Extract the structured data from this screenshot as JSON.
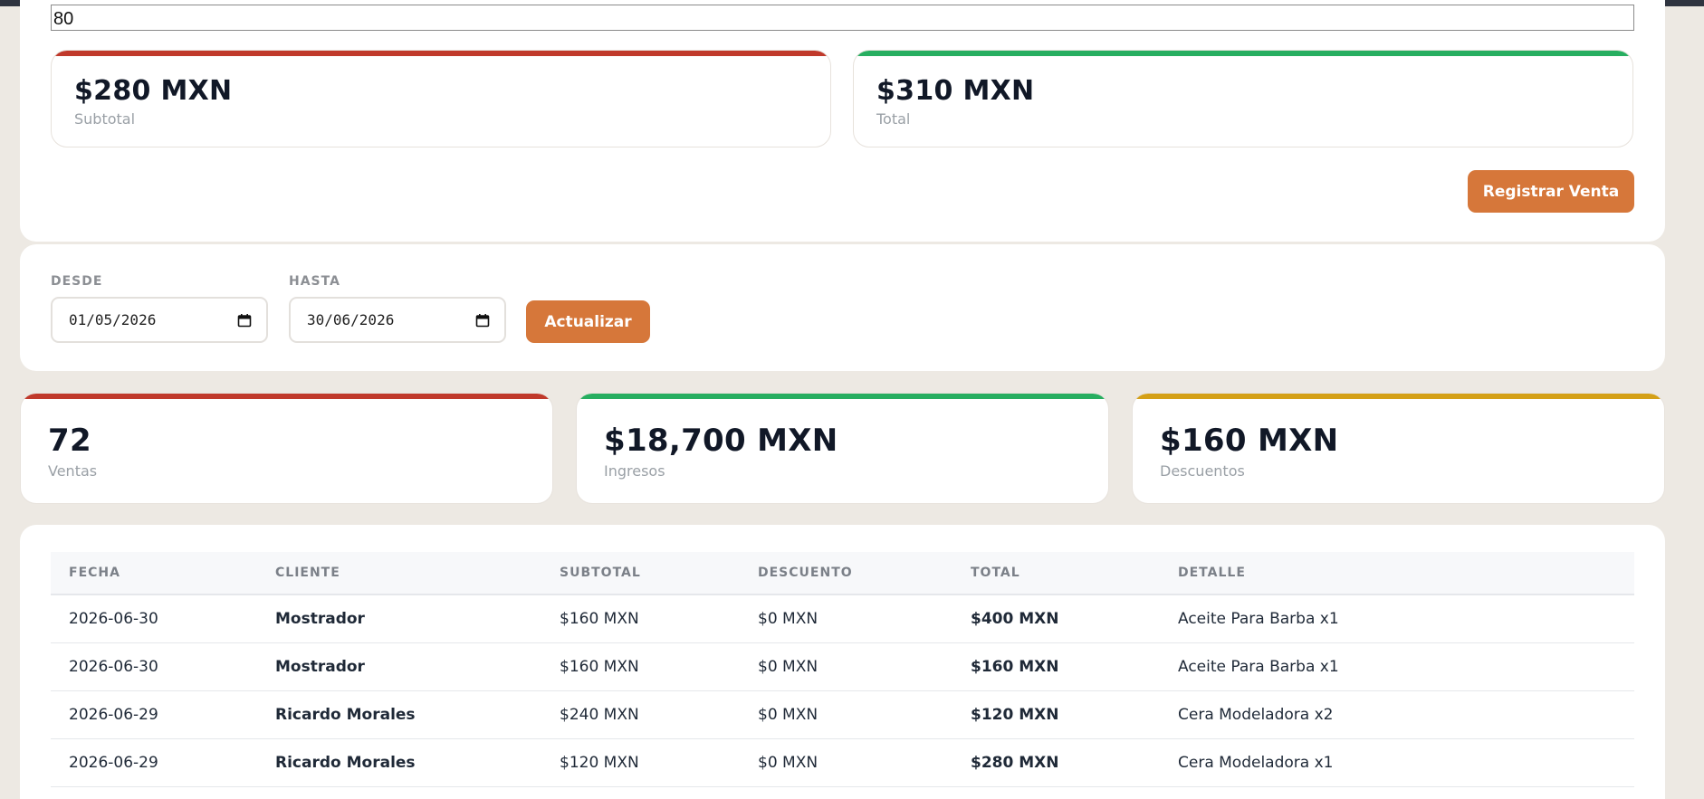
{
  "sale_form": {
    "amount_value": "80",
    "subtotal": {
      "value": "$280 MXN",
      "label": "Subtotal"
    },
    "total": {
      "value": "$310 MXN",
      "label": "Total"
    },
    "register_button": "Registrar Venta"
  },
  "filters": {
    "from_label": "DESDE",
    "from_value": "01/05/2026",
    "to_label": "HASTA",
    "to_value": "30/06/2026",
    "update_button": "Actualizar"
  },
  "summary": {
    "ventas": {
      "value": "72",
      "label": "Ventas"
    },
    "ingresos": {
      "value": "$18,700 MXN",
      "label": "Ingresos"
    },
    "descuentos": {
      "value": "$160 MXN",
      "label": "Descuentos"
    }
  },
  "table": {
    "headers": [
      "FECHA",
      "CLIENTE",
      "SUBTOTAL",
      "DESCUENTO",
      "TOTAL",
      "DETALLE"
    ],
    "rows": [
      [
        "2026-06-30",
        "Mostrador",
        "$160 MXN",
        "$0 MXN",
        "$400 MXN",
        "Aceite Para Barba x1"
      ],
      [
        "2026-06-30",
        "Mostrador",
        "$160 MXN",
        "$0 MXN",
        "$160 MXN",
        "Aceite Para Barba x1"
      ],
      [
        "2026-06-29",
        "Ricardo Morales",
        "$240 MXN",
        "$0 MXN",
        "$120 MXN",
        "Cera Modeladora x2"
      ],
      [
        "2026-06-29",
        "Ricardo Morales",
        "$120 MXN",
        "$0 MXN",
        "$280 MXN",
        "Cera Modeladora x1"
      ]
    ]
  },
  "colors": {
    "accent_red": "#c0392b",
    "accent_green": "#27ae60",
    "accent_yellow": "#d4a017",
    "button": "#d6773a",
    "discount_text": "#d49a1a"
  },
  "icons": {
    "date_picker": "calendar-icon"
  }
}
